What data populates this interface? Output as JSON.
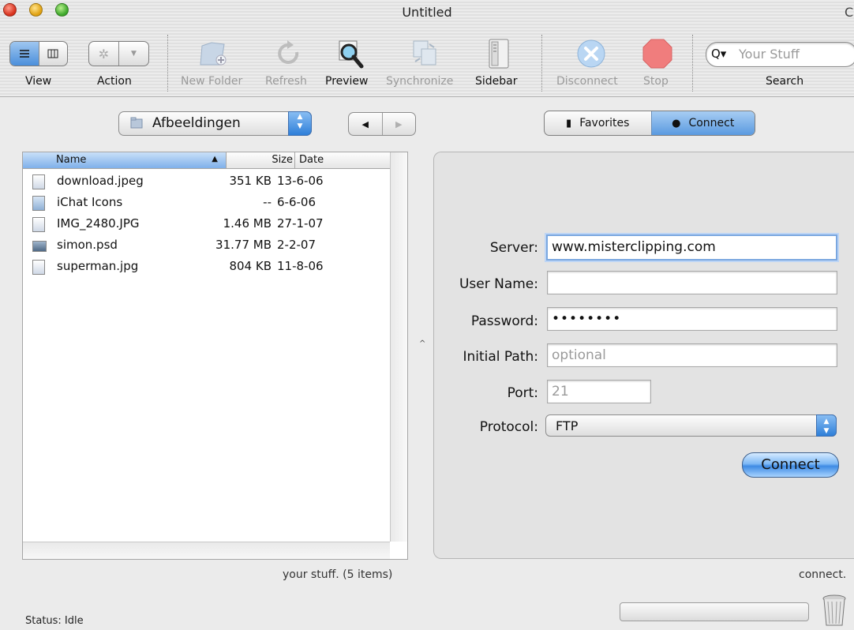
{
  "window": {
    "title": "Untitled",
    "right_glyph": "C"
  },
  "toolbar": {
    "view_label": "View",
    "action_label": "Action",
    "new_folder_label": "New Folder",
    "refresh_label": "Refresh",
    "preview_label": "Preview",
    "synchronize_label": "Synchronize",
    "sidebar_label": "Sidebar",
    "disconnect_label": "Disconnect",
    "stop_label": "Stop",
    "search_label": "Search",
    "search_placeholder": "Your Stuff"
  },
  "browser": {
    "location": "Afbeeldingen",
    "columns": {
      "name": "Name",
      "size": "Size",
      "date": "Date"
    },
    "files": [
      {
        "name": "download.jpeg",
        "size": "351 KB",
        "date": "13-6-06"
      },
      {
        "name": "iChat Icons",
        "size": "--",
        "date": "6-6-06"
      },
      {
        "name": "IMG_2480.JPG",
        "size": "1.46 MB",
        "date": "27-1-07"
      },
      {
        "name": "simon.psd",
        "size": "31.77 MB",
        "date": "2-2-07"
      },
      {
        "name": "superman.jpg",
        "size": "804 KB",
        "date": "11-8-06"
      }
    ],
    "status": "your stuff. (5 items)"
  },
  "tabs": {
    "favorites": "Favorites",
    "connect": "Connect"
  },
  "connect_form": {
    "server_label": "Server:",
    "server_value": "www.misterclipping.com",
    "username_label": "User Name:",
    "username_value": "",
    "password_label": "Password:",
    "password_value": "••••••••",
    "initial_path_label": "Initial Path:",
    "initial_path_placeholder": "optional",
    "port_label": "Port:",
    "port_placeholder": "21",
    "protocol_label": "Protocol:",
    "protocol_value": "FTP",
    "connect_button": "Connect",
    "status": "connect."
  },
  "statusbar": {
    "text": "Status: Idle"
  }
}
